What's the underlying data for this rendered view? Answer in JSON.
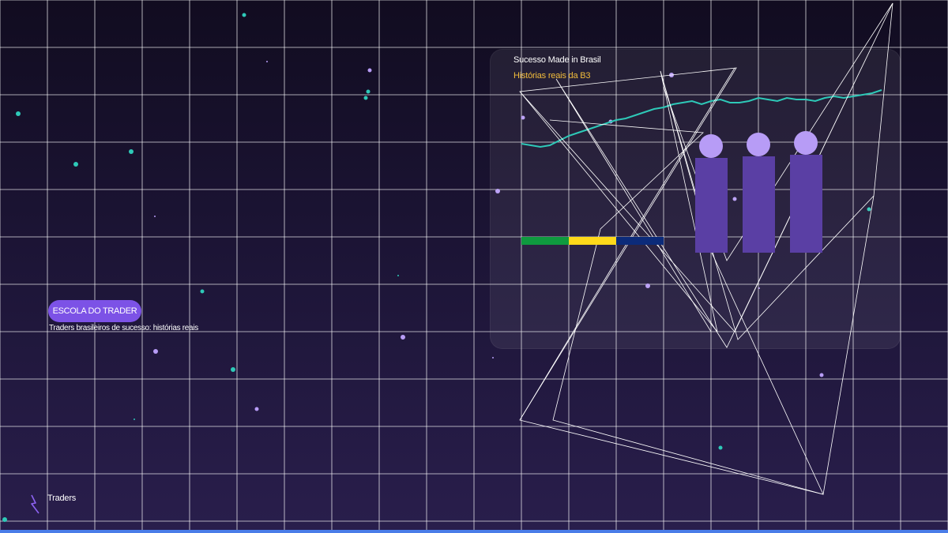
{
  "card": {
    "title": "Sucesso Made in Brasil",
    "subtitle": "Histórias reais da B3"
  },
  "hero": {
    "badge_label": "ESCOLA DO TRADER",
    "tagline": "Traders brasileiros de sucesso: histórias reais"
  },
  "footer": {
    "label": "Traders",
    "icon": "lightning-bolt-icon"
  },
  "colors": {
    "accent_purple": "#7c52e6",
    "card_gold": "#f2bd3b",
    "line_teal": "#2ec9b8",
    "figure_body": "#5a3fa4",
    "figure_head": "#b79cf6",
    "flag_green": "#0f9a3f",
    "flag_yellow": "#ffd91a",
    "flag_blue": "#0c2b7a",
    "bottom_bar": "#4a7de8"
  },
  "figures_count": 3
}
